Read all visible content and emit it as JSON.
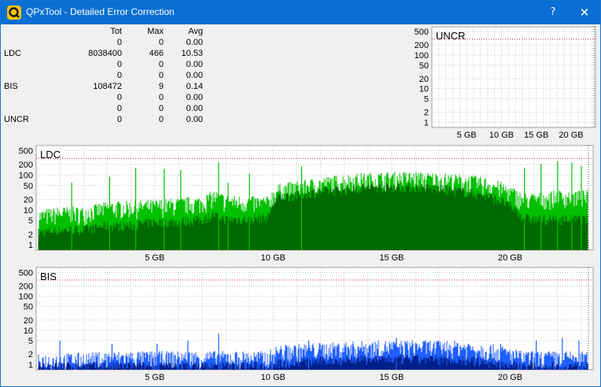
{
  "window": {
    "title": "QPxTool - Detailed Error Correction",
    "help_label": "?",
    "close_label": "✕"
  },
  "stats": {
    "headers": [
      "",
      "Tot",
      "Max",
      "Avg"
    ],
    "rows": [
      [
        "",
        "0",
        "0",
        "0.00"
      ],
      [
        "LDC",
        "8038400",
        "466",
        "10.53"
      ],
      [
        "",
        "0",
        "0",
        "0.00"
      ],
      [
        "",
        "0",
        "0",
        "0.00"
      ],
      [
        "BIS",
        "108472",
        "9",
        "0.14"
      ],
      [
        "",
        "0",
        "0",
        "0.00"
      ],
      [
        "",
        "0",
        "0",
        "0.00"
      ],
      [
        "UNCR",
        "0",
        "0",
        "0.00"
      ]
    ]
  },
  "colors": {
    "ldc_light": "#00c000",
    "ldc_dark": "#006a00",
    "bis_light": "#1f5fff",
    "bis_dark": "#001f8a",
    "grid": "#c8c8c8",
    "threshold": "#c03030"
  },
  "chart_data": [
    {
      "type": "area",
      "title": "UNCR",
      "scale": "log",
      "yticks": [
        1,
        2,
        5,
        10,
        20,
        50,
        100,
        200,
        500
      ],
      "xticks": [
        5,
        10,
        15,
        20
      ],
      "xtick_labels": [
        "5 GB",
        "10 GB",
        "15 GB",
        "20 GB"
      ],
      "xlim": [
        0,
        23.5
      ],
      "ylim": [
        0.7,
        700
      ],
      "threshold": 300,
      "x": [
        0,
        23.3
      ],
      "max": [
        0,
        0
      ],
      "avg": [
        0,
        0
      ]
    },
    {
      "type": "area",
      "title": "LDC",
      "scale": "log",
      "yticks": [
        1,
        2,
        5,
        10,
        20,
        50,
        100,
        200,
        500
      ],
      "xticks": [
        5,
        10,
        15,
        20
      ],
      "xtick_labels": [
        "5 GB",
        "10 GB",
        "15 GB",
        "20 GB"
      ],
      "xlim": [
        0,
        23.5
      ],
      "ylim": [
        0.7,
        700
      ],
      "threshold": 300,
      "x": [
        0.1,
        1,
        2,
        3,
        4,
        5,
        6,
        7,
        7.5,
        8,
        9,
        9.8,
        10.2,
        11,
        12,
        13,
        14,
        15,
        16,
        17,
        18,
        19,
        19.5,
        20,
        20.5,
        21,
        22,
        23,
        23.3
      ],
      "max": [
        8,
        10,
        10,
        14,
        15,
        16,
        18,
        20,
        30,
        22,
        20,
        20,
        45,
        55,
        70,
        85,
        95,
        100,
        100,
        95,
        85,
        70,
        55,
        40,
        25,
        25,
        30,
        30,
        30
      ],
      "avg": [
        2.5,
        3,
        3,
        4,
        4,
        5,
        5,
        6,
        8,
        6,
        6,
        7,
        25,
        30,
        38,
        44,
        50,
        52,
        50,
        45,
        38,
        28,
        22,
        14,
        7,
        6,
        6,
        6,
        6
      ],
      "spikes": [
        [
          1.5,
          60
        ],
        [
          3.1,
          90
        ],
        [
          4.2,
          160
        ],
        [
          5.4,
          150
        ],
        [
          6.1,
          140
        ],
        [
          7.7,
          230
        ],
        [
          8.1,
          60
        ],
        [
          9.0,
          110
        ],
        [
          11.2,
          180
        ],
        [
          20.6,
          160
        ],
        [
          21.3,
          210
        ],
        [
          22.0,
          250
        ],
        [
          22.6,
          230
        ],
        [
          23.0,
          180
        ]
      ]
    },
    {
      "type": "area",
      "title": "BIS",
      "scale": "log",
      "yticks": [
        1,
        2,
        5,
        10,
        20,
        50,
        100,
        200,
        500
      ],
      "xticks": [
        5,
        10,
        15,
        20
      ],
      "xtick_labels": [
        "5 GB",
        "10 GB",
        "15 GB",
        "20 GB"
      ],
      "xlim": [
        0,
        23.5
      ],
      "ylim": [
        0.7,
        700
      ],
      "threshold": 300,
      "x": [
        0.1,
        2,
        4,
        6,
        8,
        9.8,
        10.2,
        12,
        14,
        16,
        18,
        19.5,
        20.5,
        22,
        23.3
      ],
      "max": [
        1.6,
        1.8,
        2,
        2,
        2,
        2,
        3,
        3.5,
        4,
        4.2,
        4,
        3,
        2,
        2,
        2
      ],
      "avg": [
        1,
        1,
        1,
        1,
        1,
        1,
        1.2,
        1.4,
        1.6,
        1.6,
        1.5,
        1.2,
        1,
        1,
        1
      ],
      "spikes": [
        [
          1.0,
          5
        ],
        [
          3.2,
          4
        ],
        [
          5.1,
          4
        ],
        [
          6.4,
          5
        ],
        [
          7.7,
          8
        ],
        [
          11.5,
          5
        ],
        [
          15.2,
          6
        ],
        [
          19.6,
          4
        ],
        [
          21.1,
          5
        ],
        [
          22.2,
          6
        ],
        [
          22.9,
          5
        ]
      ]
    }
  ]
}
